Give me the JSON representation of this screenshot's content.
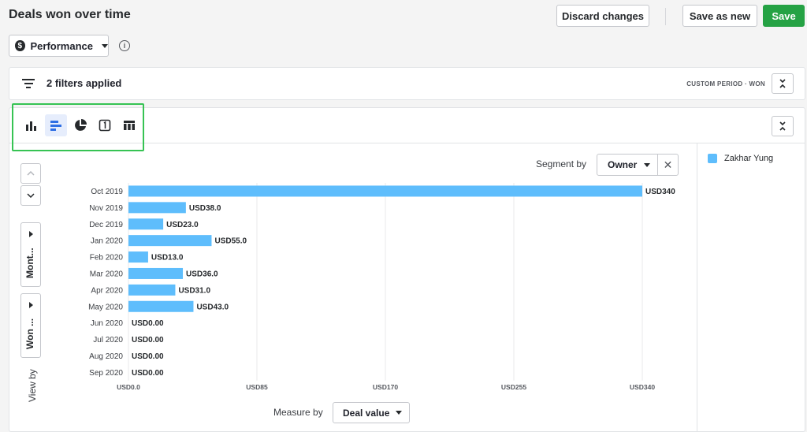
{
  "header": {
    "title": "Deals won over time",
    "discard_label": "Discard changes",
    "save_as_new_label": "Save as new",
    "save_label": "Save"
  },
  "dashboard_select": {
    "value": "Performance",
    "icon": "dollar-icon"
  },
  "filters": {
    "summary": "2 filters applied",
    "period": "CUSTOM PERIOD",
    "status": "WON"
  },
  "chart_types": [
    "column-chart-icon",
    "bar-chart-icon",
    "pie-chart-icon",
    "scorecard-icon",
    "table-icon"
  ],
  "active_chart_type": "bar-chart-icon",
  "side_controls": {
    "interval": "Mont...",
    "field": "Won ...",
    "view_by_label": "View by"
  },
  "segment": {
    "label": "Segment by",
    "value": "Owner"
  },
  "measure": {
    "label": "Measure by",
    "value": "Deal value"
  },
  "legend": [
    {
      "name": "Zakhar Yung",
      "color": "#5ebdfc"
    }
  ],
  "colors": {
    "bar": "#5ebdfc",
    "primary": "#25a244",
    "highlight": "#36c353"
  },
  "chart_data": {
    "type": "bar",
    "orientation": "horizontal",
    "categories": [
      "Oct 2019",
      "Nov 2019",
      "Dec 2019",
      "Jan 2020",
      "Feb 2020",
      "Mar 2020",
      "Apr 2020",
      "May 2020",
      "Jun 2020",
      "Jul 2020",
      "Aug 2020",
      "Sep 2020"
    ],
    "series": [
      {
        "name": "Zakhar Yung",
        "values": [
          340,
          38,
          23,
          55,
          13,
          36,
          31,
          43,
          0,
          0,
          0,
          0
        ]
      }
    ],
    "data_labels": [
      "USD340",
      "USD38.0",
      "USD23.0",
      "USD55.0",
      "USD13.0",
      "USD36.0",
      "USD31.0",
      "USD43.0",
      "USD0.00",
      "USD0.00",
      "USD0.00",
      "USD0.00"
    ],
    "x_ticks": [
      0,
      85,
      170,
      255,
      340
    ],
    "x_tick_labels": [
      "USD0.0",
      "USD85",
      "USD170",
      "USD255",
      "USD340"
    ],
    "xlim": [
      0,
      340
    ],
    "grid": true
  }
}
